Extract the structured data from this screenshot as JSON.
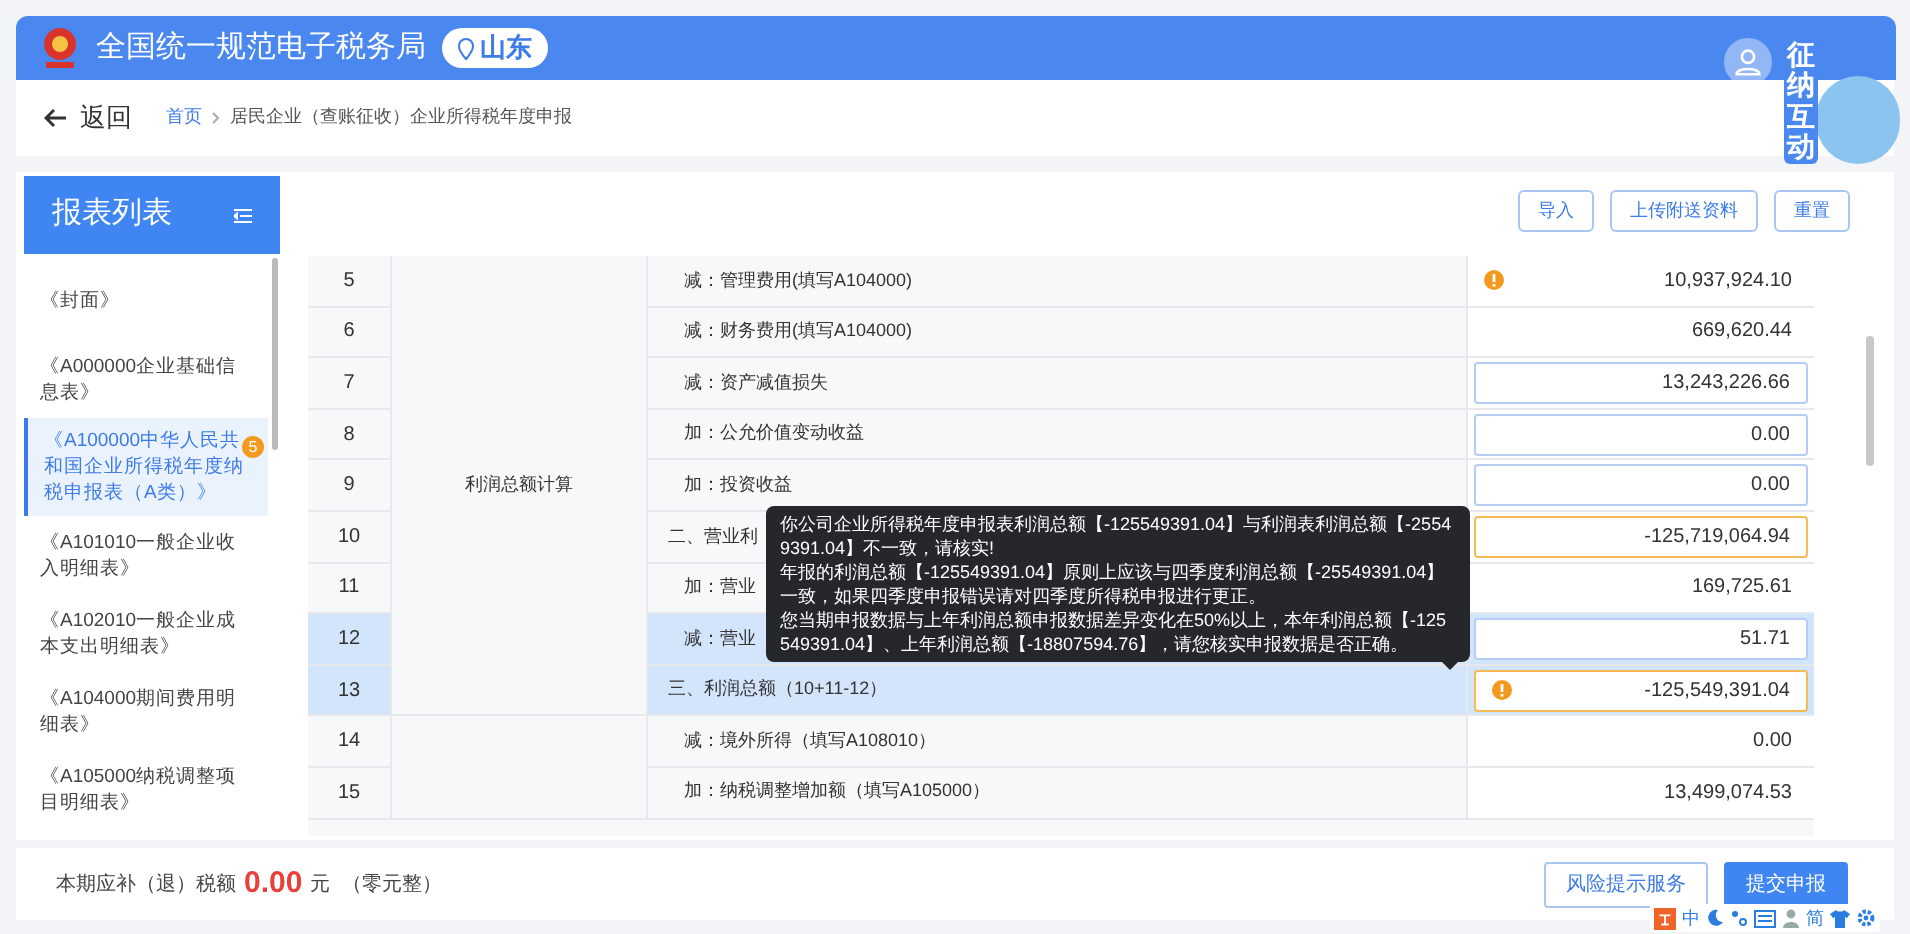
{
  "header": {
    "title": "全国统一规范电子税务局",
    "region": "山东",
    "assistant_label": "征纳互动"
  },
  "breadcrumb": {
    "back": "返回",
    "items": [
      "首页",
      "居民企业（查账征收）企业所得税年度申报"
    ]
  },
  "sidebar": {
    "title": "报表列表",
    "items": [
      {
        "label": "《封面》",
        "selected": false
      },
      {
        "label": "《A000000企业基础信息表》",
        "selected": false
      },
      {
        "label": "《A100000中华人民共和国企业所得税年度纳税申报表（A类）》",
        "selected": true,
        "badge": "5"
      },
      {
        "label": "《A101010一般企业收入明细表》",
        "selected": false
      },
      {
        "label": "《A102010一般企业成本支出明细表》",
        "selected": false
      },
      {
        "label": "《A104000期间费用明细表》",
        "selected": false
      },
      {
        "label": "《A105000纳税调整项目明细表》",
        "selected": false
      }
    ]
  },
  "toolbar": [
    "导入",
    "上传附送资料",
    "重置"
  ],
  "table": {
    "groups": [
      {
        "label": "利润总额计算",
        "rows": [
          {
            "no": "5",
            "label": "减：管理费用(填写A104000)",
            "value": "10,937,924.10",
            "input": false,
            "warning": false,
            "alert_icon": true,
            "selected": false
          },
          {
            "no": "6",
            "label": "减：财务费用(填写A104000)",
            "value": "669,620.44",
            "input": false,
            "warning": false,
            "alert_icon": false,
            "selected": false
          },
          {
            "no": "7",
            "label": "减：资产减值损失",
            "value": "13,243,226.66",
            "input": true,
            "warning": false,
            "alert_icon": false,
            "selected": false
          },
          {
            "no": "8",
            "label": "加：公允价值变动收益",
            "value": "0.00",
            "input": true,
            "warning": false,
            "alert_icon": false,
            "selected": false
          },
          {
            "no": "9",
            "label": "加：投资收益",
            "value": "0.00",
            "input": true,
            "warning": false,
            "alert_icon": false,
            "selected": false
          },
          {
            "no": "10",
            "label": "二、营业利",
            "value": "-125,719,064.94",
            "input": true,
            "warning": true,
            "alert_icon": false,
            "selected": false,
            "outdent": true
          },
          {
            "no": "11",
            "label": "加：营业",
            "value": "169,725.61",
            "input": false,
            "warning": false,
            "alert_icon": false,
            "selected": false
          },
          {
            "no": "12",
            "label": "减：营业",
            "value": "51.71",
            "input": true,
            "warning": false,
            "alert_icon": false,
            "selected": true
          },
          {
            "no": "13",
            "label": "三、利润总额（10+11-12）",
            "value": "-125,549,391.04",
            "input": true,
            "warning": true,
            "alert_icon": true,
            "selected": true,
            "outdent": true
          }
        ]
      },
      {
        "rows": [
          {
            "no": "14",
            "label": "减：境外所得（填写A108010）",
            "value": "0.00",
            "input": false,
            "warning": false,
            "alert_icon": false,
            "selected": false
          },
          {
            "no": "15",
            "label": "加：纳税调整增加额（填写A105000）",
            "value": "13,499,074.53",
            "input": false,
            "warning": false,
            "alert_icon": false,
            "selected": false
          }
        ]
      }
    ]
  },
  "tooltip": [
    "你公司企业所得税年度申报表利润总额【-125549391.04】与利润表利润总额【-25549391.04】不一致，请核实!",
    "年报的利润总额【-125549391.04】原则上应该与四季度利润总额【-25549391.04】一致，如果四季度申报错误请对四季度所得税申报进行更正。",
    "您当期申报数据与上年利润总额申报数据差异变化在50%以上，本年利润总额【-125549391.04】、上年利润总额【-18807594.76】，请您核实申报数据是否正确。"
  ],
  "footer": {
    "label": "本期应补（退）税额",
    "amount": "0.00",
    "unit": "元",
    "words": "（零元整）",
    "buttons": [
      {
        "label": "风险提示服务",
        "kind": "outline"
      },
      {
        "label": "提交申报",
        "kind": "primary"
      }
    ]
  },
  "ime": {
    "mode": "中",
    "script": "简"
  }
}
